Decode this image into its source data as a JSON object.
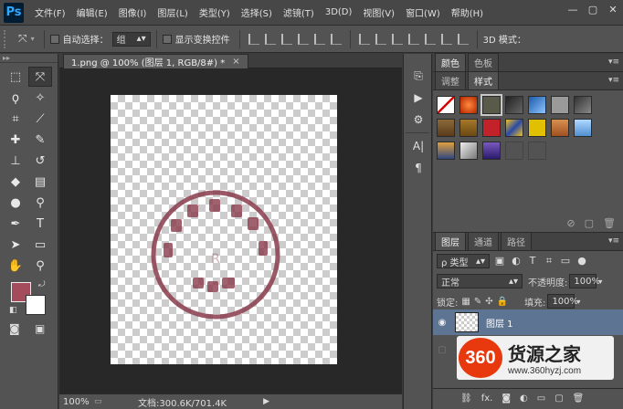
{
  "app": {
    "logo": "Ps"
  },
  "menu": [
    "文件(F)",
    "编辑(E)",
    "图像(I)",
    "图层(L)",
    "类型(Y)",
    "选择(S)",
    "滤镜(T)",
    "3D(D)",
    "视图(V)",
    "窗口(W)",
    "帮助(H)"
  ],
  "window_controls": [
    "—",
    "▢",
    "✕"
  ],
  "options": {
    "move_icon": "move-tool-icon",
    "auto_select_label": "自动选择：",
    "auto_select_value": "组",
    "show_transform_label": "显示变换控件",
    "mode_3d_label": "3D 模式："
  },
  "document": {
    "tab_title": "1.png @ 100% (图层 1, RGB/8#) *",
    "close": "×"
  },
  "stamp": {
    "arc_text": "日期年月日",
    "center_text": "R",
    "bottom_text": "印章",
    "color": "#8a3c4c"
  },
  "status": {
    "zoom": "100%",
    "docsize": "文档:300.6K/701.4K",
    "arrow": "▶"
  },
  "colors": {
    "foreground": "#a44b5c",
    "background": "#ffffff"
  },
  "panel_top": {
    "tabs": [
      "颜色",
      "色板"
    ]
  },
  "panel_styles": {
    "tabs": [
      "调整",
      "样式"
    ]
  },
  "layers": {
    "tabs": [
      "图层",
      "通道",
      "路径"
    ],
    "filter_label": "ρ 类型",
    "blend_mode": "正常",
    "opacity_label": "不透明度:",
    "opacity_value": "100%",
    "lock_label": "锁定:",
    "fill_label": "填充:",
    "fill_value": "100%",
    "layer_name": "图层 1",
    "footer_fx": "fx."
  },
  "watermark": {
    "logo": "360",
    "title": "货源之家",
    "url": "www.360hyzj.com"
  }
}
